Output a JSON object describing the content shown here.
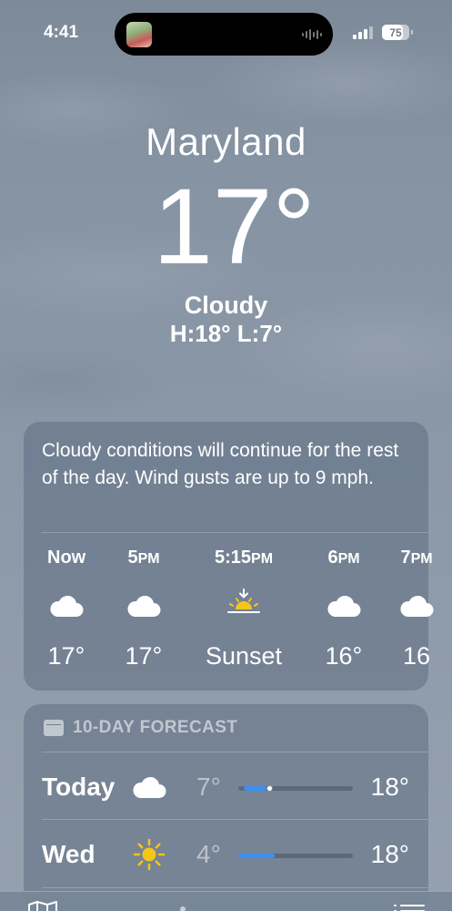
{
  "status_bar": {
    "time": "4:41",
    "battery": "75",
    "battery_level": 0.75,
    "signal_bars": 3,
    "signal_max": 4
  },
  "hero": {
    "location": "Maryland",
    "temperature": "17°",
    "condition": "Cloudy",
    "high_low": "H:18°  L:7°"
  },
  "hourly": {
    "summary": "Cloudy conditions will continue for the rest of the day. Wind gusts are up to 9 mph.",
    "items": [
      {
        "label": "Now",
        "suffix": "",
        "icon": "cloud-icon",
        "temp": "17°"
      },
      {
        "label": "5",
        "suffix": "PM",
        "icon": "cloud-icon",
        "temp": "17°"
      },
      {
        "label": "5:15",
        "suffix": "PM",
        "icon": "sunset-icon",
        "temp": "Sunset"
      },
      {
        "label": "6",
        "suffix": "PM",
        "icon": "cloud-icon",
        "temp": "16°"
      },
      {
        "label": "7",
        "suffix": "PM",
        "icon": "cloud-icon",
        "temp": "16"
      }
    ]
  },
  "forecast": {
    "header": "10-DAY FORECAST",
    "header_icon": "calendar-icon",
    "days": [
      {
        "day": "Today",
        "icon": "cloud-icon",
        "low": "7°",
        "high": "18°",
        "range_start": 0.05,
        "range_end": 0.25,
        "current": 0.27
      },
      {
        "day": "Wed",
        "icon": "sun-icon",
        "low": "4°",
        "high": "18°",
        "range_start": 0.0,
        "range_end": 0.32,
        "current": null
      }
    ]
  },
  "toolbar": {
    "left_icon": "map-icon",
    "right_icon": "list-icon"
  },
  "colors": {
    "range_bar": "#3d8ef0",
    "sun": "#f5c518"
  }
}
